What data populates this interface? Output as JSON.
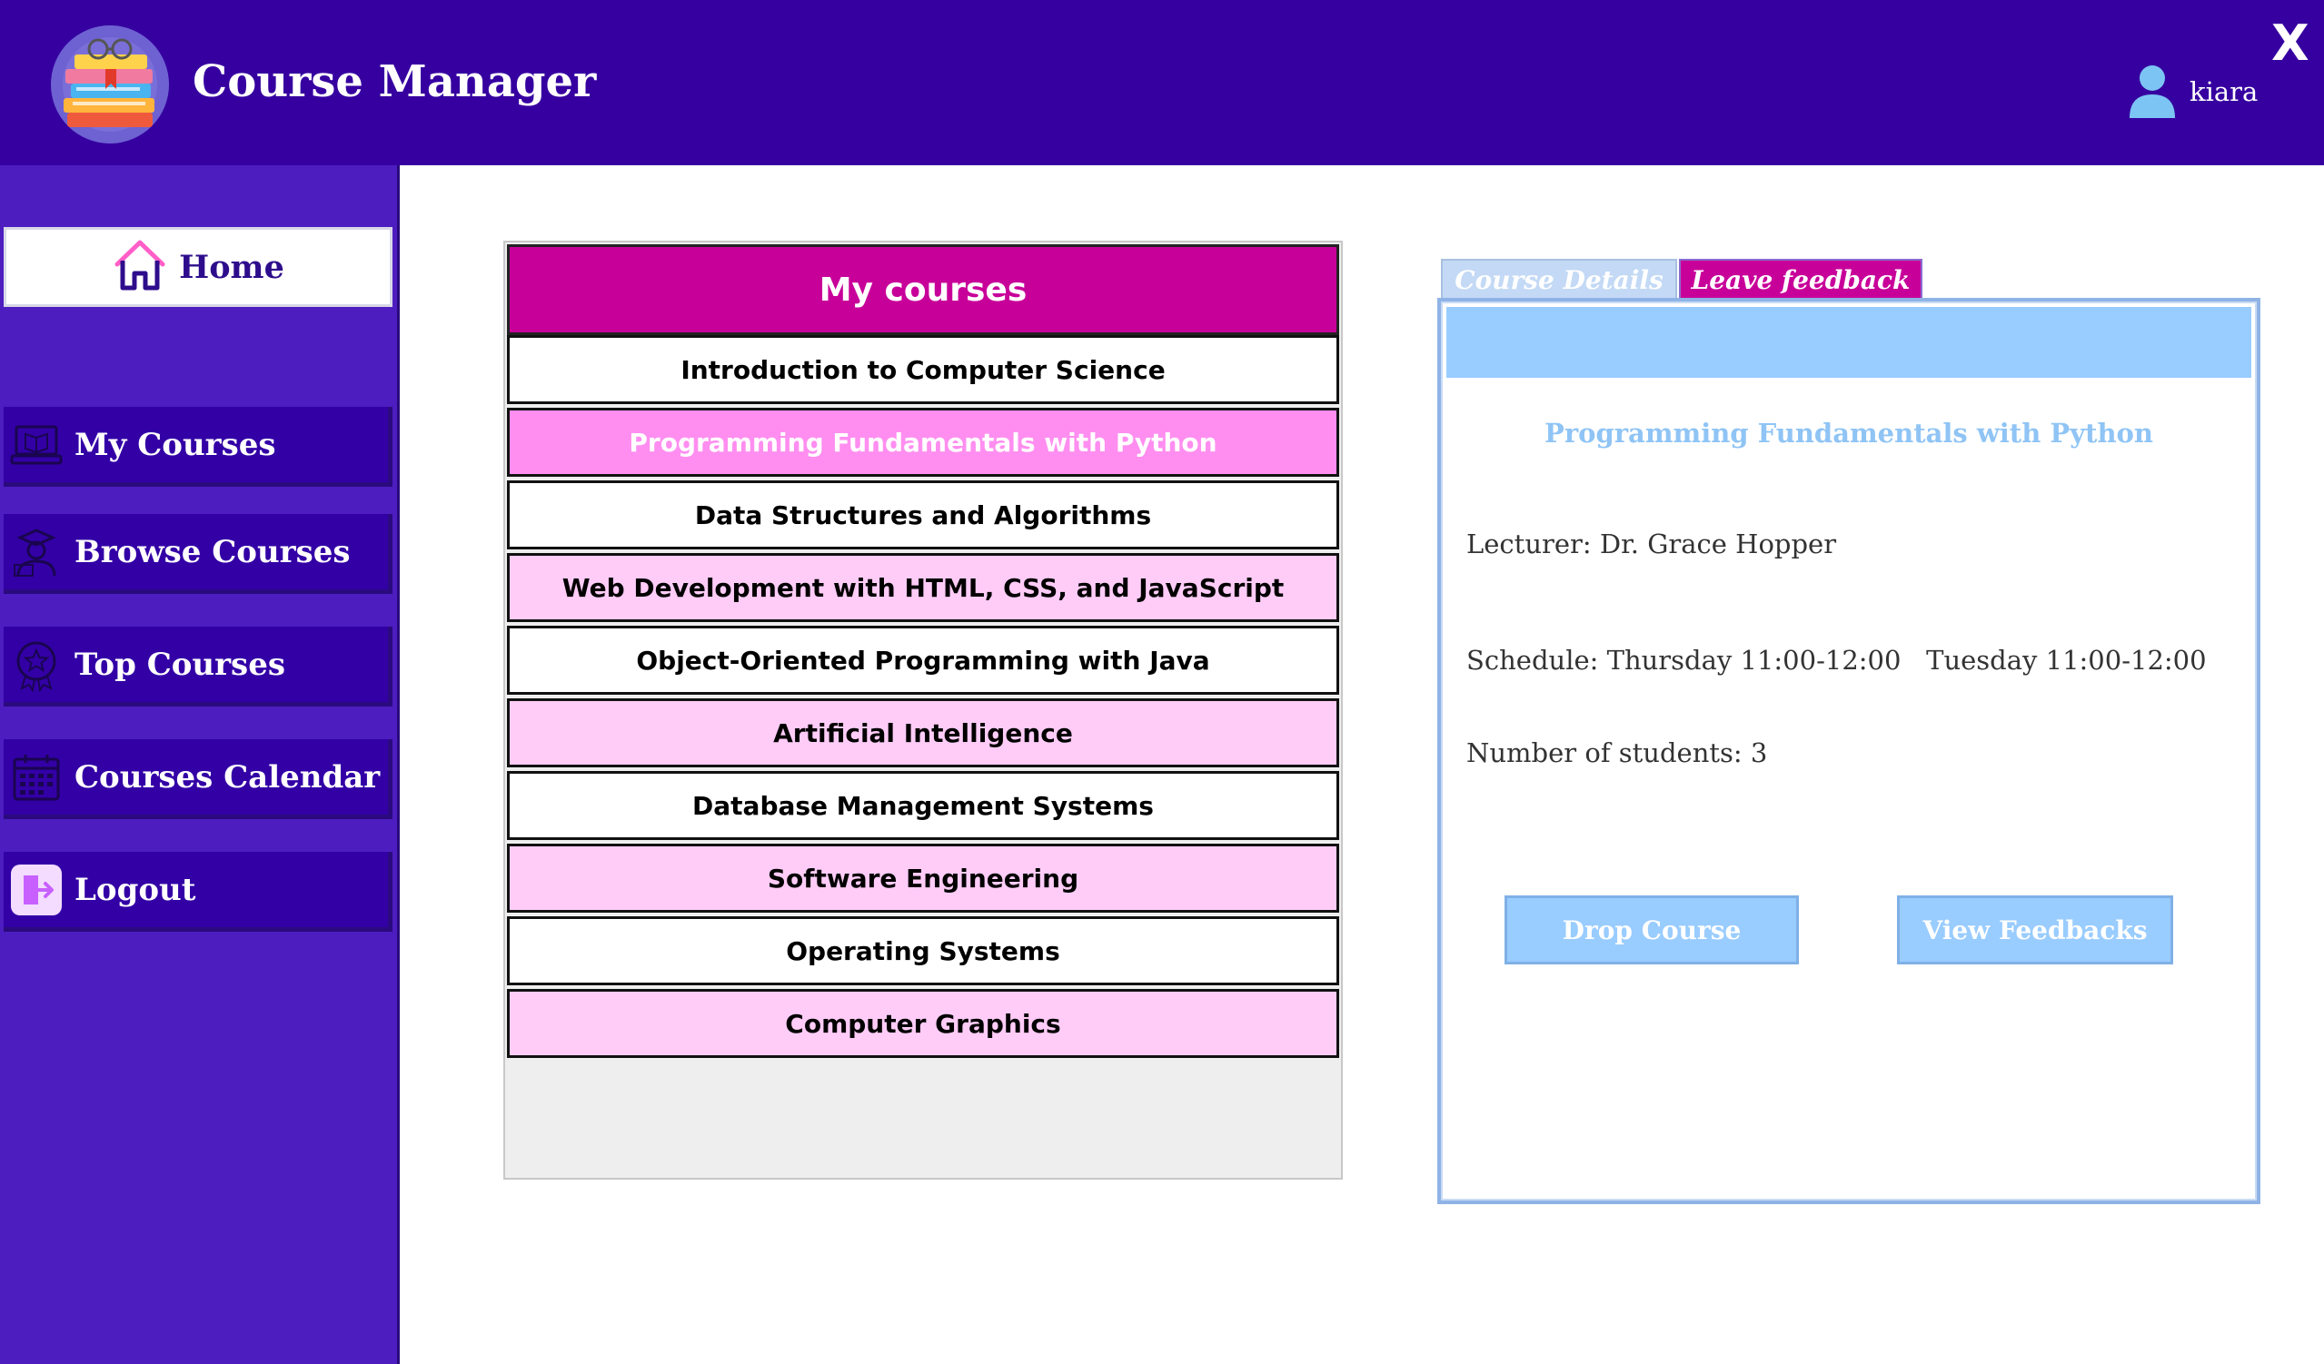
{
  "header": {
    "app_title": "Course Manager",
    "username": "kiara",
    "close_label": "X"
  },
  "sidebar": {
    "home_label": "Home",
    "items": [
      {
        "label": "My Courses",
        "icon": "laptop-book-icon"
      },
      {
        "label": "Browse Courses",
        "icon": "teacher-icon"
      },
      {
        "label": "Top Courses",
        "icon": "star-badge-icon"
      },
      {
        "label": "Courses Calendar",
        "icon": "calendar-icon"
      },
      {
        "label": "Logout",
        "icon": "logout-icon"
      }
    ]
  },
  "courses": {
    "header": "My courses",
    "items": [
      {
        "label": "Introduction to Computer Science",
        "style": "white"
      },
      {
        "label": "Programming Fundamentals with Python",
        "style": "selected"
      },
      {
        "label": "Data Structures and Algorithms",
        "style": "white"
      },
      {
        "label": "Web Development with HTML, CSS, and JavaScript",
        "style": "pink"
      },
      {
        "label": "Object-Oriented Programming with Java",
        "style": "white"
      },
      {
        "label": "Artificial Intelligence",
        "style": "pink"
      },
      {
        "label": "Database Management Systems",
        "style": "white"
      },
      {
        "label": "Software Engineering",
        "style": "pink"
      },
      {
        "label": "Operating Systems",
        "style": "white"
      },
      {
        "label": "Computer Graphics",
        "style": "pink"
      }
    ]
  },
  "details": {
    "tabs": {
      "course_details": "Course Details",
      "leave_feedback": "Leave feedback"
    },
    "course_name": "Programming Fundamentals with Python",
    "lecturer": "Lecturer: Dr. Grace Hopper",
    "schedule": "Schedule: Thursday 11:00-12:00   Tuesday 11:00-12:00",
    "students": "Number of students: 3",
    "drop_label": "Drop Course",
    "feedbacks_label": "View Feedbacks"
  },
  "colors": {
    "header_bg": "#3600a0",
    "sidebar_bg": "#4d1dc0",
    "accent_magenta": "#c8009a",
    "row_pink": "#ffccf7",
    "row_selected": "#ff8ef0",
    "light_blue": "#99ccff"
  }
}
